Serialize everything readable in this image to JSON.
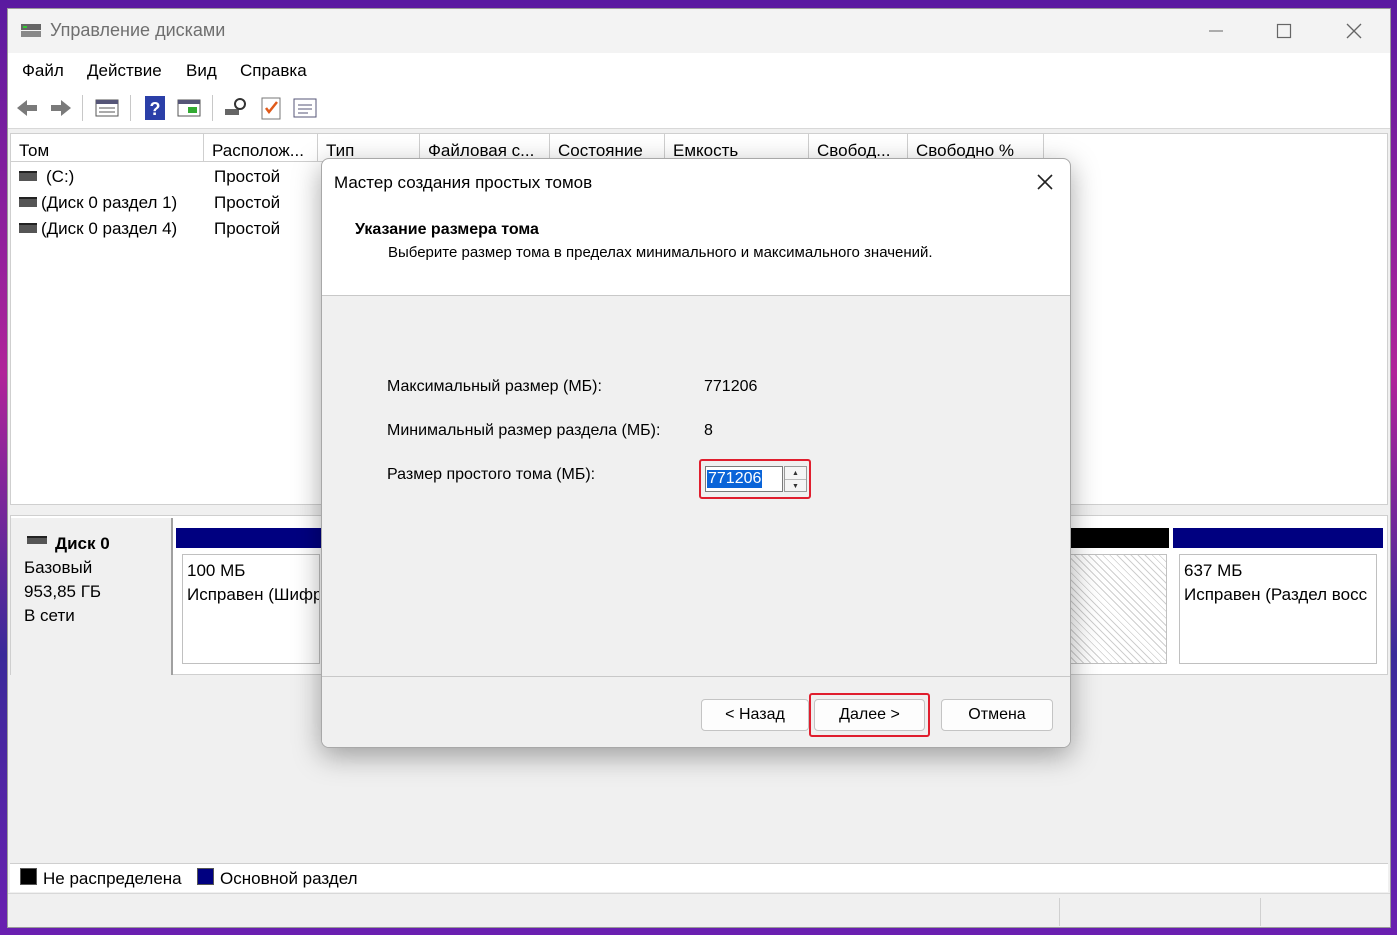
{
  "window": {
    "title": "Управление дисками"
  },
  "menu": [
    "Файл",
    "Действие",
    "Вид",
    "Справка"
  ],
  "toolbar_icons": [
    "back-arrow-icon",
    "forward-arrow-icon",
    "disk-list-icon",
    "help-icon",
    "disk-view-icon",
    "rescan-icon",
    "checklist-icon",
    "properties-icon"
  ],
  "volume_table": {
    "columns": [
      "Том",
      "Располож...",
      "Тип",
      "Файловая с...",
      "Состояние",
      "Емкость",
      "Свобод...",
      "Свободно %"
    ],
    "rows": [
      {
        "name": "(C:)",
        "layout": "Простой"
      },
      {
        "name": "(Диск 0 раздел 1)",
        "layout": "Простой"
      },
      {
        "name": "(Диск 0 раздел 4)",
        "layout": "Простой"
      }
    ]
  },
  "disk": {
    "name": "Диск 0",
    "type": "Базовый",
    "size": "953,85 ГБ",
    "status": "В сети",
    "partitions": [
      {
        "size": "100 МБ",
        "status": "Исправен (Шифр"
      },
      {
        "size": "637 МБ",
        "status": "Исправен (Раздел восс"
      }
    ]
  },
  "legend": {
    "unallocated": "Не распределена",
    "primary": "Основной раздел"
  },
  "colors": {
    "primary_partition": "#000080",
    "unallocated": "#000000",
    "highlight": "#e01e2e",
    "selection": "#0a64d8"
  },
  "dialog": {
    "title": "Мастер создания простых томов",
    "header_title": "Указание размера тома",
    "header_subtitle": "Выберите размер тома в пределах минимального и максимального значений.",
    "max_label": "Максимальный размер (МБ):",
    "max_value": "771206",
    "min_label": "Минимальный размер раздела (МБ):",
    "min_value": "8",
    "size_label": "Размер простого тома (МБ):",
    "size_value": "771206",
    "back_button": "< Назад",
    "next_button": "Далее >",
    "cancel_button": "Отмена"
  }
}
